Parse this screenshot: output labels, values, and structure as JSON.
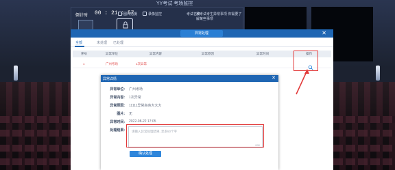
{
  "app": {
    "title": "YY考试  考场监控"
  },
  "exam_panel": {
    "timer_label": "倒计时",
    "timer_value": "00 : 21 : 57",
    "checkboxes": [
      "图片拍摄",
      "录像监控"
    ],
    "right_info": [
      "考试名称",
      "被考试考生异常事项  你需要了解某些事项"
    ]
  },
  "exception_list": {
    "title": "异常处理",
    "close_label": "✕",
    "tabs": [
      "全部",
      "未处理",
      "已处理"
    ],
    "columns": [
      "序号",
      "异常单位",
      "异常内容",
      "异常原因",
      "异常时间",
      "操作"
    ],
    "rows": [
      {
        "index": "1",
        "unit": "广州考场",
        "content": "1次异常",
        "reason": "",
        "time": ""
      }
    ]
  },
  "detail_modal": {
    "title": "异常详情",
    "close_label": "✕",
    "fields": [
      {
        "label": "异常单位:",
        "value": "广州考场"
      },
      {
        "label": "异常内容:",
        "value": "1次异常"
      },
      {
        "label": "异常原因:",
        "value": "11111异常高亮大大大"
      },
      {
        "label": "图片:",
        "value": "无"
      },
      {
        "label": "异常时间:",
        "value": "2022-08-22 17:05"
      }
    ],
    "result_label": "处理结果:",
    "result_placeholder": "请输入异常处理结果, 至多50个字",
    "result_counter": "0/50",
    "confirm_label": "确认处理"
  },
  "colors": {
    "primary": "#1f66b3",
    "highlight": "#e23a3a",
    "error_text": "#e05050"
  }
}
